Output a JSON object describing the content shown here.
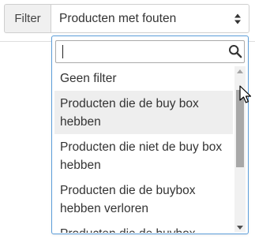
{
  "filter": {
    "label": "Filter",
    "selected_value": "Producten met fouten"
  },
  "dropdown": {
    "search_value": "",
    "options": [
      {
        "label": "Geen filter",
        "highlighted": false
      },
      {
        "label": "Producten die de buy box hebben",
        "highlighted": true
      },
      {
        "label": "Producten die niet de buy box hebben",
        "highlighted": false
      },
      {
        "label": "Producten die de buybox hebben verloren",
        "highlighted": false
      },
      {
        "label": "Producten die de buybox",
        "highlighted": false
      }
    ]
  },
  "colors": {
    "dropdown_border": "#5b9dd9",
    "highlight_bg": "#eeeeee",
    "scroll_thumb": "#a8a8a8"
  },
  "icons": [
    "sort-caret-icon",
    "search-icon",
    "scroll-up-arrow-icon",
    "scroll-down-arrow-icon",
    "mouse-pointer-icon"
  ]
}
